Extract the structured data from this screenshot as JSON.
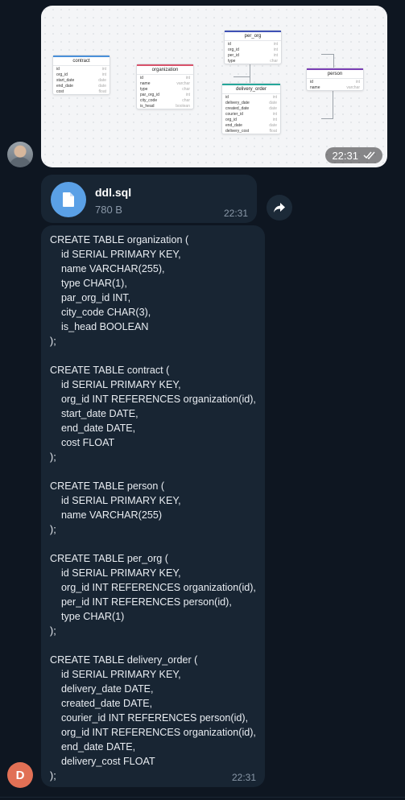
{
  "messages": {
    "image": {
      "time": "22:31",
      "diagram": {
        "tables": [
          {
            "name": "contract",
            "color": "#4a90d9",
            "rows": [
              [
                "id",
                "int"
              ],
              [
                "org_id",
                "int"
              ],
              [
                "start_date",
                "date"
              ],
              [
                "end_date",
                "date"
              ],
              [
                "cost",
                "float"
              ]
            ]
          },
          {
            "name": "organization",
            "color": "#d9536b",
            "rows": [
              [
                "id",
                "int"
              ],
              [
                "name",
                "varchar"
              ],
              [
                "type",
                "char"
              ],
              [
                "par_org_id",
                "int"
              ],
              [
                "city_code",
                "char"
              ],
              [
                "is_head",
                "boolean"
              ]
            ]
          },
          {
            "name": "per_org",
            "color": "#3f51b5",
            "rows": [
              [
                "id",
                "int"
              ],
              [
                "org_id",
                "int"
              ],
              [
                "per_id",
                "int"
              ],
              [
                "type",
                "char"
              ]
            ]
          },
          {
            "name": "delivery_order",
            "color": "#26a69a",
            "rows": [
              [
                "id",
                "int"
              ],
              [
                "delivery_date",
                "date"
              ],
              [
                "created_date",
                "date"
              ],
              [
                "courier_id",
                "int"
              ],
              [
                "org_id",
                "int"
              ],
              [
                "end_date",
                "date"
              ],
              [
                "delivery_cost",
                "float"
              ]
            ]
          },
          {
            "name": "person",
            "color": "#7b3fb5",
            "rows": [
              [
                "id",
                "int"
              ],
              [
                "name",
                "varchar"
              ]
            ]
          }
        ]
      }
    },
    "file": {
      "name": "ddl.sql",
      "size": "780 B",
      "time": "22:31"
    },
    "text": {
      "body": "CREATE TABLE organization (\n    id SERIAL PRIMARY KEY,\n    name VARCHAR(255),\n    type CHAR(1),\n    par_org_id INT,\n    city_code CHAR(3),\n    is_head BOOLEAN\n);\n\nCREATE TABLE contract (\n    id SERIAL PRIMARY KEY,\n    org_id INT REFERENCES organization(id),\n    start_date DATE,\n    end_date DATE,\n    cost FLOAT\n);\n\nCREATE TABLE person (\n    id SERIAL PRIMARY KEY,\n    name VARCHAR(255)\n);\n\nCREATE TABLE per_org (\n    id SERIAL PRIMARY KEY,\n    org_id INT REFERENCES organization(id),\n    per_id INT REFERENCES person(id),\n    type CHAR(1)\n);\n\nCREATE TABLE delivery_order (\n    id SERIAL PRIMARY KEY,\n    delivery_date DATE,\n    created_date DATE,\n    courier_id INT REFERENCES person(id),\n    org_id INT REFERENCES organization(id),\n    end_date DATE,\n    delivery_cost FLOAT\n);",
      "time": "22:31"
    }
  },
  "sender_avatar_letter": "D",
  "icons": {
    "file": "file-icon",
    "share": "share-icon",
    "read": "double-check-icon"
  }
}
